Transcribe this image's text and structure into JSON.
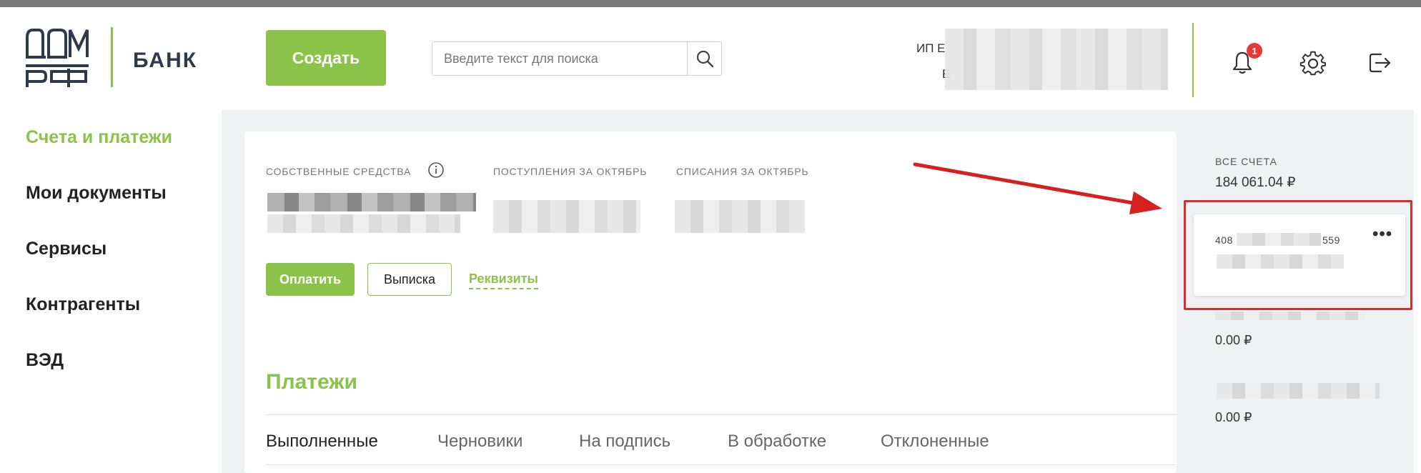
{
  "header": {
    "brand": "БАНК",
    "create_label": "Создать",
    "search_placeholder": "Введите текст для поиска",
    "user_prefix_1": "ИП Е",
    "user_prefix_2": "Е",
    "notification_count": "1"
  },
  "sidebar": {
    "items": [
      {
        "label": "Счета и платежи",
        "active": true
      },
      {
        "label": "Мои документы",
        "active": false
      },
      {
        "label": "Сервисы",
        "active": false
      },
      {
        "label": "Контрагенты",
        "active": false
      },
      {
        "label": "ВЭД",
        "active": false
      }
    ]
  },
  "main": {
    "stats": {
      "own_funds_label": "СОБСТВЕННЫЕ СРЕДСТВА",
      "income_label": "ПОСТУПЛЕНИЯ ЗА ОКТЯБРЬ",
      "expenses_label": "СПИСАНИЯ ЗА ОКТЯБРЬ"
    },
    "actions": {
      "pay_label": "Оплатить",
      "statement_label": "Выписка",
      "requisites_label": "Реквизиты"
    },
    "payments_title": "Платежи",
    "tabs": [
      {
        "label": "Выполненные",
        "active": true
      },
      {
        "label": "Черновики",
        "active": false
      },
      {
        "label": "На подпись",
        "active": false
      },
      {
        "label": "В обработке",
        "active": false
      },
      {
        "label": "Отклоненные",
        "active": false
      }
    ]
  },
  "accounts": {
    "all_label": "ВСЕ СЧЕТА",
    "all_amount": "184 061.04 ₽",
    "selected_number_start": "408",
    "selected_number_end": "559",
    "more_label": "•••",
    "second_amount": "0.00 ₽",
    "third_amount": "0.00 ₽"
  },
  "colors": {
    "accent": "#8bc34a",
    "highlight": "#d32f2f",
    "badge": "#e53935"
  }
}
